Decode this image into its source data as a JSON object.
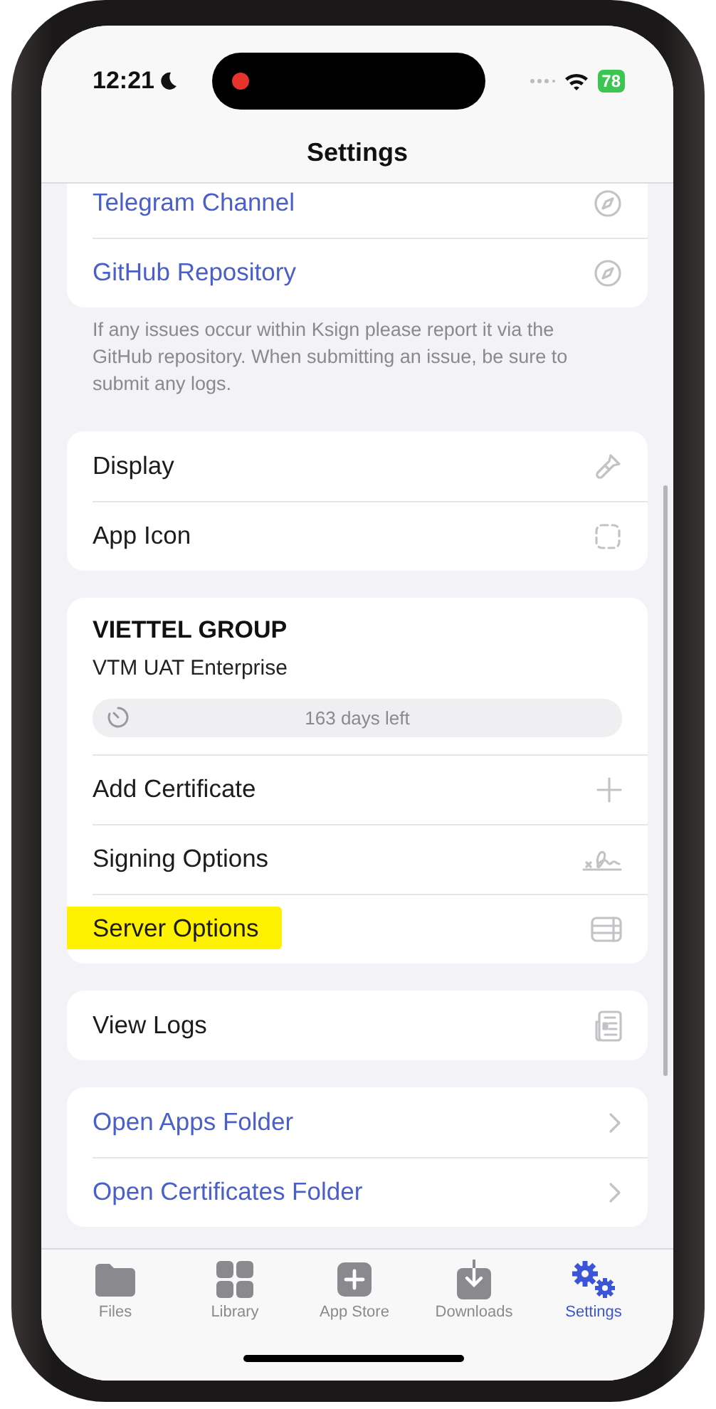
{
  "status_bar": {
    "time": "12:21",
    "battery": "78"
  },
  "nav": {
    "title": "Settings"
  },
  "sections": [
    {
      "rows": [
        {
          "label": "Telegram Channel",
          "kind": "link",
          "highlighted": false
        },
        {
          "label": "GitHub Repository",
          "kind": "link",
          "highlighted": false
        }
      ],
      "footer": "If any issues occur within Ksign please report it via the GitHub repository. When submitting an issue, be sure to submit any logs."
    },
    {
      "rows": [
        {
          "label": "Display",
          "kind": "plain",
          "highlighted": false
        },
        {
          "label": "App Icon",
          "kind": "plain",
          "highlighted": false
        }
      ]
    },
    {
      "certificate": {
        "name": "VIETTEL GROUP",
        "subtitle": "VTM UAT Enterprise",
        "expiry": "163 days left"
      },
      "rows": [
        {
          "label": "Add Certificate",
          "kind": "plain",
          "highlighted": false
        },
        {
          "label": "Signing Options",
          "kind": "plain",
          "highlighted": false
        },
        {
          "label": "Server Options",
          "kind": "plain",
          "highlighted": true
        }
      ]
    },
    {
      "rows": [
        {
          "label": "View Logs",
          "kind": "plain",
          "highlighted": false
        }
      ]
    },
    {
      "rows": [
        {
          "label": "Open Apps Folder",
          "kind": "link",
          "highlighted": false
        },
        {
          "label": "Open Certificates Folder",
          "kind": "link",
          "highlighted": false
        }
      ]
    }
  ],
  "tabs": [
    {
      "label": "Files",
      "selected": false
    },
    {
      "label": "Library",
      "selected": false
    },
    {
      "label": "App Store",
      "selected": false
    },
    {
      "label": "Downloads",
      "selected": false
    },
    {
      "label": "Settings",
      "selected": true
    }
  ]
}
